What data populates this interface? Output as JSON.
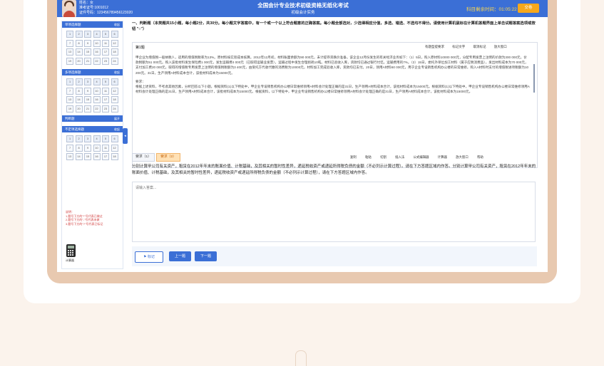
{
  "header": {
    "candidate_name": "姓名：女",
    "candidate_exam_id": "准考证号:1001012",
    "candidate_cert_id": "证件号码：123456789456123020",
    "exam_title": "全国会计专业技术初级资格无纸化考试",
    "exam_subject": "初级会计实务",
    "timer_label": "科目剩余时间：",
    "timer_value": "01:05:22",
    "submit_label": "交卷"
  },
  "sidebar": {
    "sections": [
      {
        "label": "单项选择题",
        "toggle": "收起",
        "count": 24
      },
      {
        "label": "多项选择题",
        "toggle": "收起",
        "count": 24
      },
      {
        "label": "判断题",
        "toggle": "展开"
      },
      {
        "label": "不定项选择题",
        "toggle": "收起",
        "count": 18
      }
    ],
    "hints": [
      "说明：",
      "1.题号下方的\"*\"号代表已做过",
      "2.题号下方的\"-\"号代表未做",
      "3.题号下方的\"?\"号代表已标记"
    ],
    "calculator_label": "计算器"
  },
  "question": {
    "header": "一、判断题（本类题共15小题，每小题2分，共30分。每小题文字答案中，有一个或一个以上符合题意的正确答案。每小题全部选对，少选得相应分值，多选、错选、不选均不得分。请使用计算机鼠标在计算机答题界面上单击试题答案选项或按钮 \"○\"）",
    "case_no": "第1题",
    "case_tools": [
      "有题型提要求",
      "标记文字",
      "取消标记",
      "放大窗口"
    ],
    "case_text_1": "甲企业为增值税一般纳税人，适用的增值税税率为13%。原材料按实际成本核算。2012年12月初，材料账面余额为90 000元，未计提存货跌价准备。该企业12月份发生的有关经济业务如下：（1）5日，购入原材料10000 000元，分配专用发票上注明的价款为300 000元，价款税额为51 000元。购入该批材料发生保险费1 000元，发生运输费4 000元（已取得运输业发票），运输过程中发生合理损耗10吨。材料已验收入库，货款均已通过银行付讫。运输费用的7%。（2）15日，委托外单位加工材料（属于应税消费品），发出材料成本为70 000元，支付加工费20 000元，取得的增值税专用发票上注明的增值税税额为3 400元，由受托方代收代缴的消费税为10000元，材料加工完成验收入库，货款均已支付。20日，领用A材料60 000元，用于企业专设销售机构办公楼的日常维修，购入A材料时支付的增值税进项税额为10 200元。31日，生产领用A材料成本合计，该批材料成本为15000元。",
    "requirements_label": "要求：",
    "case_text_2": "根据上述资料，不考虑其他因素，分析回答以下小题。根据资料(1)以下特处中，甲企业专设销售机构办公楼日常维修领用A材料会计处理正确的是31日，生产领用A材料成本合计，该批材料成本为15000元。根据资料(1)以下特处中，甲企业专设销售机构办公楼日常维修领用A材料会计处理正确的是31日，生产领用A材料成本合计，该批材料成本为15000元。根据资料，以下特处中，甲企业专设销售机构办公楼日常维修领用A材料会计处理正确的是31日，生产领用A材料成本合计，该批材料成本为15000元。",
    "tabs": [
      "要求（1）",
      "要求（2）"
    ],
    "sub_tools": [
      "复制",
      "粘贴",
      "切割",
      "插入法",
      "公式编辑器",
      "计算器",
      "放大窗口",
      "帮助"
    ],
    "ask_text": "分别计算甲公司有关资产，租赁在2012年年末的账面价值、计税基础，及其相关的暂时性差异，递延税收资产或递延所得税负债的金额（不必列示计算过程）。请在下方答题区域内作答。分别计算甲公司有关资产，租赁在2012年年末的账面价值、计税基础，及其相关的暂时性差异，递延税收资产或递延所得税负债的金额（不必列示计算过程），请在下方答题区域内作答。",
    "answer_placeholder": "请输入答案..."
  },
  "footer": {
    "mark_label": "标记",
    "prev_label": "上一题",
    "next_label": "下一题"
  }
}
